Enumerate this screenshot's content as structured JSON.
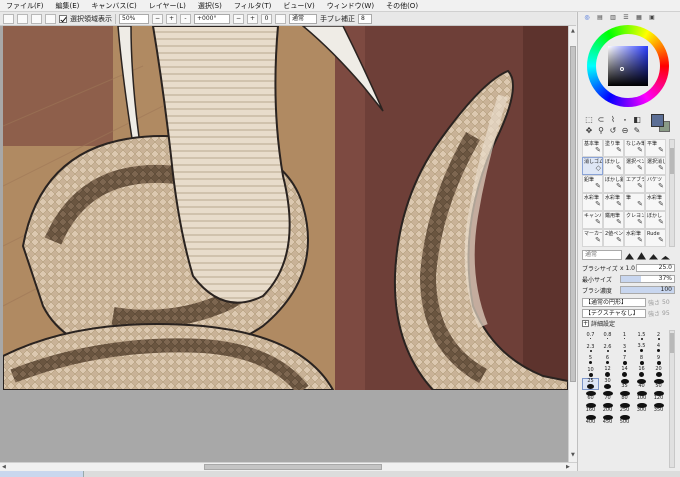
{
  "menu": [
    "ファイル(F)",
    "編集(E)",
    "キャンバス(C)",
    "レイヤー(L)",
    "選択(S)",
    "フィルタ(T)",
    "ビュー(V)",
    "ウィンドウ(W)",
    "その他(O)"
  ],
  "toolbar": {
    "show_selection_label": "選択領域表示",
    "show_selection_checked": true,
    "zoom": "50%",
    "zoom_minus": "−",
    "zoom_plus": "+",
    "zoom_reset": "-",
    "rotation": "+000°",
    "rotate_minus": "−",
    "rotate_plus": "+",
    "rotate_reset": "0",
    "blend_mode": "通常",
    "stabilizer_label": "手ブレ補正",
    "stabilizer_value": "8"
  },
  "colors": {
    "canvas_bg": "#a8a8a8",
    "wall": "#b08a62",
    "plank": "#6e3f38",
    "snake_light": "#e3d2bd",
    "snake_dark": "#6a5540",
    "outline": "#2a2320",
    "foreground": "#5b6e95",
    "background": "#8a9b86"
  },
  "panel": {
    "tabs": [
      "◎",
      "▤",
      "▥",
      "☰",
      "▦",
      "▣"
    ],
    "tool_icons": [
      "⬚",
      "⊂",
      "⌇",
      "⬞",
      "◧",
      "✥",
      "⚲",
      "↺",
      "⊖",
      "✎"
    ],
    "brushes": [
      {
        "label": "基本筆",
        "icon": "✎"
      },
      {
        "label": "塗り筆",
        "icon": "✎"
      },
      {
        "label": "なじみ筆",
        "icon": "✎"
      },
      {
        "label": "平筆",
        "icon": "✎"
      },
      {
        "label": "消しゴム",
        "icon": "◇",
        "selected": true
      },
      {
        "label": "ぼかし",
        "icon": "✎"
      },
      {
        "label": "選択ペン",
        "icon": "✎"
      },
      {
        "label": "選択消し",
        "icon": "✎"
      },
      {
        "label": "鉛筆",
        "icon": "✎"
      },
      {
        "label": "ぼかし鉛",
        "icon": "✎"
      },
      {
        "label": "エアブラシ",
        "icon": "✎"
      },
      {
        "label": "バケツ",
        "icon": "✎"
      },
      {
        "label": "水彩筆",
        "icon": "✎"
      },
      {
        "label": "水彩筆",
        "icon": "✎"
      },
      {
        "label": "筆",
        "icon": "✎"
      },
      {
        "label": "水彩筆",
        "icon": "✎"
      },
      {
        "label": "キャンバス",
        "icon": "✎"
      },
      {
        "label": "鐵用筆",
        "icon": "✎"
      },
      {
        "label": "クレヨン",
        "icon": "✎"
      },
      {
        "label": "ぼかし",
        "icon": "✎"
      },
      {
        "label": "マーカー",
        "icon": "✎"
      },
      {
        "label": "2値ペン",
        "icon": "✎"
      },
      {
        "label": "水彩筆",
        "icon": "✎"
      },
      {
        "label": "Rude",
        "icon": "✎"
      }
    ],
    "blend": "通常",
    "brush_size_label": "ブラシサイズ",
    "brush_size_mult": "x 1.0",
    "brush_size_value": "25.0",
    "min_size_label": "最小サイズ",
    "min_size_value": "37%",
    "min_size_level": 37,
    "density_label": "ブラシ濃度",
    "density_value": "100",
    "density_level": 100,
    "shape_label": "【通常の円形】",
    "texture_label": "【テクスチャなし】",
    "strength_label": "強さ",
    "strength_value": "50",
    "strength2_value": "95",
    "detail_label": "詳細設定",
    "sizes": [
      "0.7",
      "0.8",
      "1",
      "1.5",
      "2",
      "2.3",
      "2.6",
      "3",
      "3.5",
      "4",
      "5",
      "6",
      "7",
      "8",
      "9",
      "10",
      "12",
      "14",
      "16",
      "20",
      "25",
      "30",
      "35",
      "40",
      "50",
      "60",
      "70",
      "80",
      "100",
      "120",
      "160",
      "200",
      "250",
      "300",
      "350",
      "400",
      "450",
      "500"
    ]
  }
}
